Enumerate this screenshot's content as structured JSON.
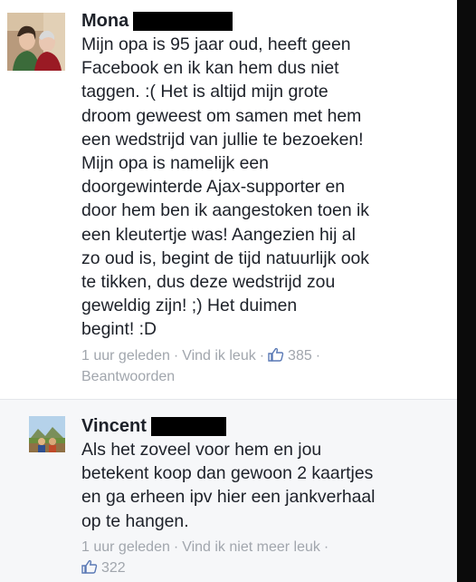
{
  "colors": {
    "name": "#1d2129",
    "text": "#1d2129",
    "meta": "#a1a6ad",
    "like_blue": "#5a79b5",
    "reply_bg": "#f6f7f9"
  },
  "comments": [
    {
      "author": "Mona",
      "name_redacted": true,
      "text": "Mijn opa is 95 jaar oud, heeft geen\nFacebook en ik kan hem dus niet\ntaggen. :( Het is altijd mijn grote\ndroom geweest om samen met hem\neen wedstrijd van jullie te bezoeken!\nMijn opa is namelijk een\ndoorgewinterde Ajax-supporter en\ndoor hem ben ik aangestoken toen ik\neen kleutertje was! Aangezien hij al\nzo oud is, begint de tijd natuurlijk ook\nte tikken, dus deze wedstrijd zou\ngeweldig zijn! ;) Het duimen\nbegint! :D",
      "time": "1 uur geleden",
      "like_action": "Vind ik leuk",
      "like_icon": "thumbs-up-icon",
      "like_count": "385",
      "reply_action": "Beantwoorden"
    },
    {
      "author": "Vincent",
      "name_redacted": true,
      "text": "Als het zoveel voor hem en jou\nbetekent koop dan gewoon 2 kaartjes\nen ga erheen ipv hier een jankverhaal\nop te hangen.",
      "time": "1 uur geleden",
      "like_action": "Vind ik niet meer leuk",
      "like_icon": "thumbs-up-icon",
      "like_count": "322"
    }
  ]
}
